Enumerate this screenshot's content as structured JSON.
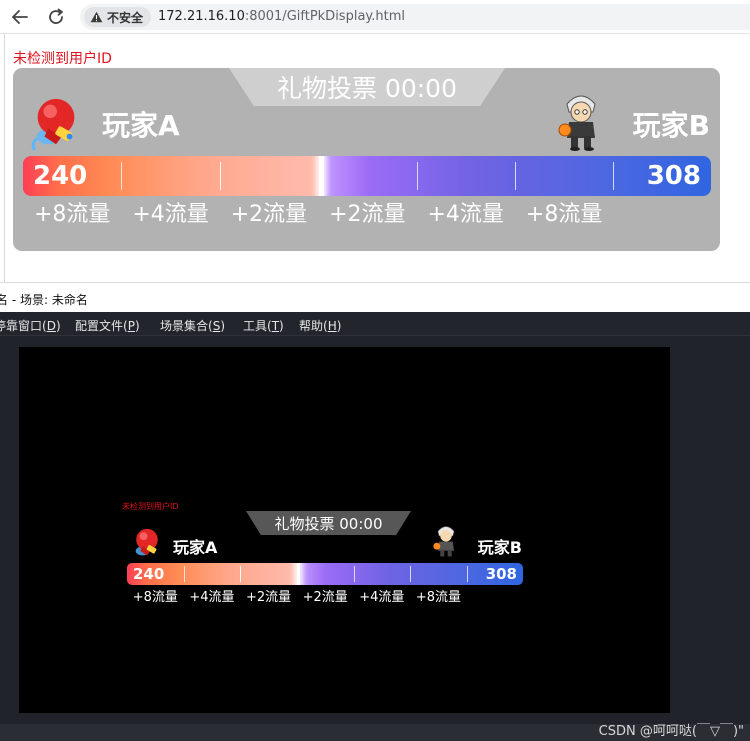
{
  "browser": {
    "insecure_label": "不安全",
    "url_host": "172.21.16.10",
    "url_rest": ":8001/GiftPkDisplay.html"
  },
  "page": {
    "status_message": "未检测到用户ID"
  },
  "pk": {
    "title": "礼物投票 00:00",
    "player_a": "玩家A",
    "player_b": "玩家B",
    "score_a": "240",
    "score_b": "308",
    "score_a_value": 240,
    "score_b_value": 308,
    "multipliers": [
      "+8流量",
      "+4流量",
      "+2流量",
      "+2流量",
      "+4流量",
      "+8流量"
    ],
    "colors": {
      "panel_bg": "#b2b2b2",
      "side_a_start": "#ff3f55",
      "side_a_end": "#ffbcb0",
      "side_b_start": "#c69bff",
      "side_b_end": "#2f66e0",
      "status_red": "#e0141e"
    },
    "avatar_a_icon": "boxing-glove-icon",
    "avatar_b_icon": "cartoon-player-icon"
  },
  "obs": {
    "title": "名 - 场景: 未命名",
    "menu": [
      {
        "pre": "停靠窗口(",
        "key": "D",
        "post": ")"
      },
      {
        "pre": "配置文件(",
        "key": "P",
        "post": ")"
      },
      {
        "pre": "场景集合(",
        "key": "S",
        "post": ")"
      },
      {
        "pre": "工具(",
        "key": "T",
        "post": ")"
      },
      {
        "pre": "帮助(",
        "key": "H",
        "post": ")"
      }
    ],
    "watermark": "CSDN @呵呵哒(￣▽￣)\""
  }
}
